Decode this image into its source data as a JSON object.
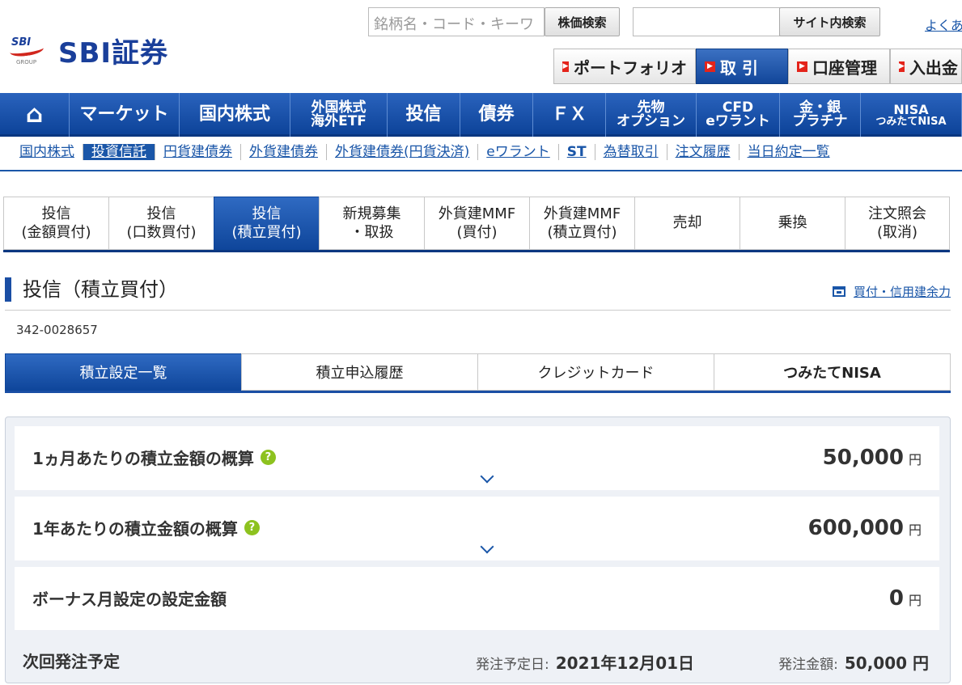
{
  "header": {
    "logo_text": "SBI証券",
    "stock_search_placeholder": "銘柄名・コード・キーワ",
    "stock_search_button": "株価検索",
    "site_search_button": "サイト内検索",
    "help_link": "よくあ"
  },
  "util_nav": [
    {
      "label": "ポートフォリオ",
      "active": false
    },
    {
      "label": "取 引",
      "active": true
    },
    {
      "label": "口座管理",
      "active": false
    },
    {
      "label": "入出金",
      "active": false
    }
  ],
  "global_nav": [
    {
      "l1": "⌂",
      "l2": ""
    },
    {
      "l1": "マーケット",
      "l2": ""
    },
    {
      "l1": "国内株式",
      "l2": ""
    },
    {
      "l1": "外国株式",
      "l2": "海外ETF"
    },
    {
      "l1": "投信",
      "l2": ""
    },
    {
      "l1": "債券",
      "l2": ""
    },
    {
      "l1": "ＦＸ",
      "l2": ""
    },
    {
      "l1": "先物",
      "l2": "オプション"
    },
    {
      "l1": "CFD",
      "l2": "eワラント"
    },
    {
      "l1": "金・銀",
      "l2": "プラチナ"
    },
    {
      "l1": "NISA",
      "l2": "つみたてNISA"
    }
  ],
  "sub_nav": [
    "国内株式",
    "投資信託",
    "円貨建債券",
    "外貨建債券",
    "外貨建債券(円貨決済)",
    "eワラント",
    "ST",
    "為替取引",
    "注文履歴",
    "当日約定一覧"
  ],
  "trade_tabs": [
    {
      "l1": "投信",
      "l2": "(金額買付)"
    },
    {
      "l1": "投信",
      "l2": "(口数買付)"
    },
    {
      "l1": "投信",
      "l2": "(積立買付)"
    },
    {
      "l1": "新規募集",
      "l2": "・取扱"
    },
    {
      "l1": "外貨建MMF",
      "l2": "(買付)"
    },
    {
      "l1": "外貨建MMF",
      "l2": "(積立買付)"
    },
    {
      "l1": "売却",
      "l2": ""
    },
    {
      "l1": "乗換",
      "l2": ""
    },
    {
      "l1": "注文照会",
      "l2": "(取消)"
    }
  ],
  "page": {
    "title": "投信（積立買付）",
    "buy_power_link": "買付・信用建余力",
    "account_no": "342-0028657"
  },
  "plan_tabs": [
    "積立設定一覧",
    "積立申込履歴",
    "クレジットカード",
    "つみたてNISA"
  ],
  "summary": {
    "monthly_label": "1ヵ月あたりの積立金額の概算",
    "monthly_value": "50,000",
    "yearly_label": "1年あたりの積立金額の概算",
    "yearly_value": "600,000",
    "bonus_label": "ボーナス月設定の設定金額",
    "bonus_value": "0",
    "unit": "円",
    "help_glyph": "?"
  },
  "next_order": {
    "label": "次回発注予定",
    "date_caption": "発注予定日:",
    "date_value": "2021年12月01日",
    "amount_caption": "発注金額:",
    "amount_value": "50,000 円"
  },
  "colors": {
    "brand_blue": "#1a4ea4",
    "accent_red": "#e4241b",
    "help_green": "#8dc21f"
  }
}
